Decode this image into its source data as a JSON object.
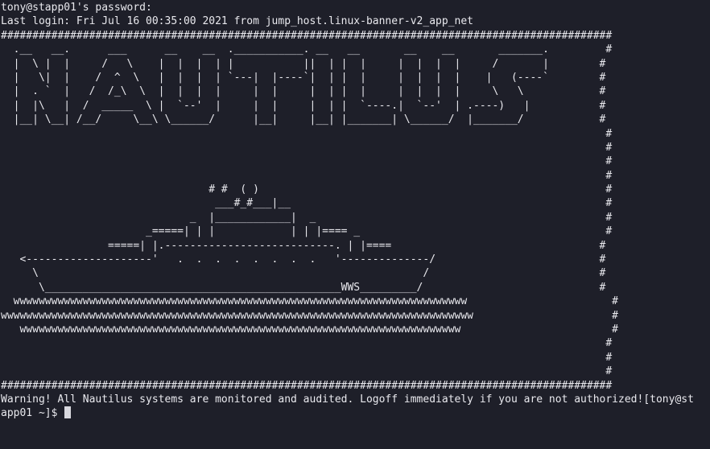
{
  "terminal": {
    "lines": [
      "tony@stapp01's password:",
      "Last login: Fri Jul 16 00:35:00 2021 from jump_host.linux-banner-v2_app_net",
      "#################################################################################################",
      "  .__   __.      ___      __    __  .___________. __   __       __    __       _______.         #",
      "  |  \\ |  |     /   \\    |  |  |  | |           ||  | |  |     |  |  |  |     /       |        #",
      "  |   \\|  |    /  ^  \\   |  |  |  | `---|  |----`|  | |  |     |  |  |  |    |   (----`        #",
      "  |  . `  |   /  /_\\  \\  |  |  |  |     |  |     |  | |  |     |  |  |  |     \\   \\            #",
      "  |  |\\   |  /  _____  \\ |  `--'  |     |  |     |  | |  `----.|  `--'  | .----)   |           #",
      "  |__| \\__| /__/     \\__\\ \\______/      |__|     |__| |_______| \\______/  |_______/            #",
      "                                                                                                #",
      "                                                                                                #",
      "                                                                                                #",
      "                                                                                                #",
      "                                 # #  ( )                                                       #",
      "                                  ___#_#___|__                                                  #",
      "                              _  |____________|  _                                              #",
      "                       _=====| | |            | | |==== _                                       #",
      "                 =====| |.---------------------------. | |====                                 #",
      "   <--------------------'   .  .  .  .  .  .  .  .   '--------------/                          #",
      "     \\                                                             /                           #",
      "      \\_______________________________________________WWS_________/                            #",
      "  wwwwwwwwwwwwwwwwwwwwwwwwwwwwwwwwwwwwwwwwwwwwwwwwwwwwwwwwwwwwwwwwwwwwwwww                       #",
      "wwwwwwwwwwwwwwwwwwwwwwwwwwwwwwwwwwwwwwwwwwwwwwwwwwwwwwwwwwwwwwwwwwwwwwwwwww                      #",
      "   wwwwwwwwwwwwwwwwwwwwwwwwwwwwwwwwwwwwwwwwwwwwwwwwwwwwwwwwwwwwwwwwwwwwww                        #",
      "                                                                                                #",
      "                                                                                                #",
      "                                                                                                #",
      "#################################################################################################",
      "Warning! All Nautilus systems are monitored and audited. Logoff immediately if you are not authorized![tony@st"
    ],
    "prompt": "app01 ~]$ "
  }
}
